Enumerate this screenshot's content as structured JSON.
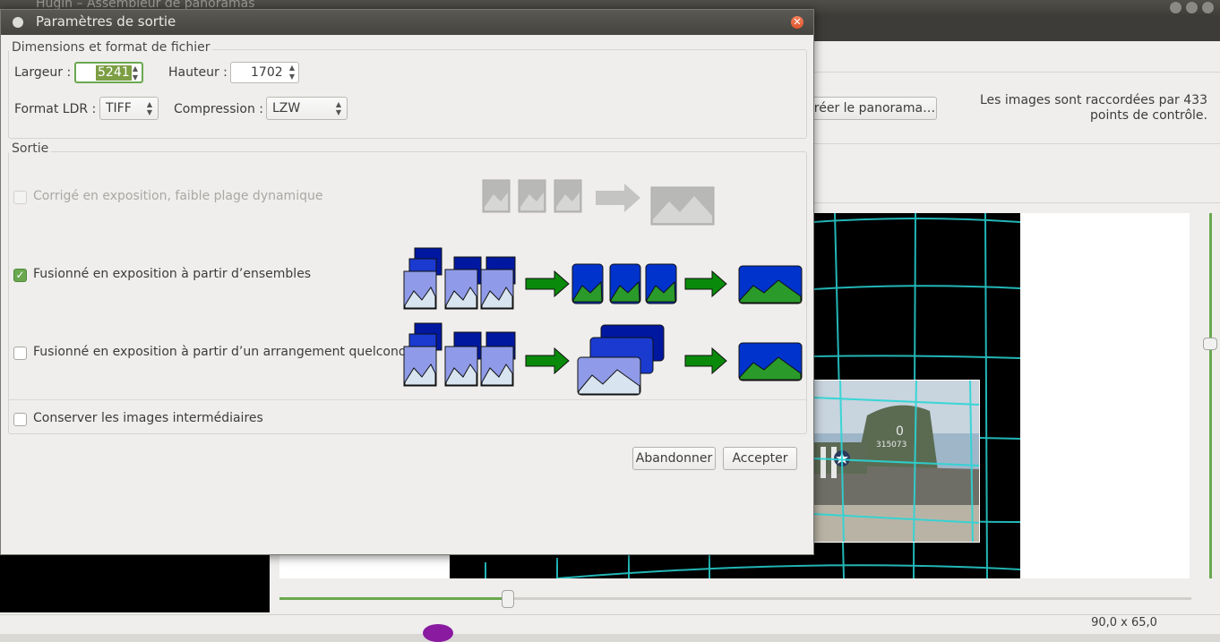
{
  "main_window": {
    "title": "Hugin – Assembleur de panoramas",
    "create_panorama_label": "Créer le panorama…",
    "control_points_info": "Les images sont raccordées par 433 points de contrôle.",
    "field_of_view": "90,0 x 65,0"
  },
  "dialog": {
    "title": "Paramètres de sortie",
    "dimensions_section": {
      "legend": "Dimensions et format de fichier",
      "width_label": "Largeur :",
      "width_value": "5241",
      "height_label": "Hauteur :",
      "height_value": "1702",
      "ldr_format_label": "Format LDR :",
      "ldr_format_value": "TIFF",
      "compression_label": "Compression :",
      "compression_value": "LZW"
    },
    "output_section": {
      "legend": "Sortie",
      "options": [
        {
          "label": "Corrigé en exposition, faible plage dynamique",
          "checked": false,
          "enabled": false
        },
        {
          "label": "Fusionné en exposition à partir d’ensembles",
          "checked": true,
          "enabled": true
        },
        {
          "label": "Fusionné en exposition à partir d’un arrangement quelconque",
          "checked": false,
          "enabled": true
        }
      ],
      "keep_intermediate_label": "Conserver les images intermédiaires",
      "keep_intermediate_checked": false
    },
    "buttons": {
      "cancel": "Abandonner",
      "accept": "Accepter"
    }
  },
  "colors": {
    "accent_green": "#6aa84f",
    "title_bar": "#45443f",
    "close_button": "#e0542c",
    "grid_cyan": "#2ad6d6",
    "sky_blue": "#0033cc",
    "arrow_green": "#0a8a0a"
  }
}
